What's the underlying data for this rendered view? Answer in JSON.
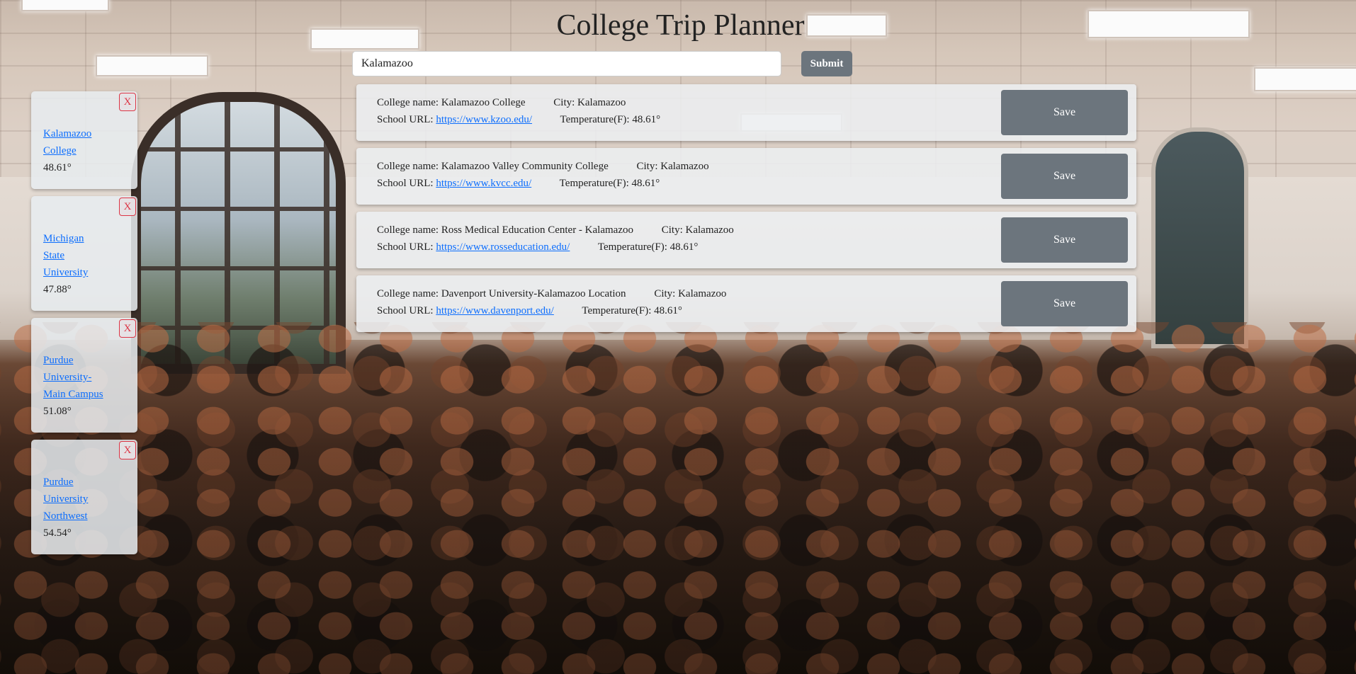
{
  "header": {
    "title": "College Trip Planner"
  },
  "search": {
    "value": "Kalamazoo",
    "submit_label": "Submit"
  },
  "results": [
    {
      "name_label": "College name:",
      "name": "Kalamazoo College",
      "city_label": "City:",
      "city": "Kalamazoo",
      "url_label": "School URL:",
      "url": "https://www.kzoo.edu/",
      "temp_label": "Temperature(F):",
      "temp": "48.61°",
      "save_label": "Save"
    },
    {
      "name_label": "College name:",
      "name": "Kalamazoo Valley Community College",
      "city_label": "City:",
      "city": "Kalamazoo",
      "url_label": "School URL:",
      "url": "https://www.kvcc.edu/",
      "temp_label": "Temperature(F):",
      "temp": "48.61°",
      "save_label": "Save"
    },
    {
      "name_label": "College name:",
      "name": "Ross Medical Education Center - Kalamazoo",
      "city_label": "City:",
      "city": "Kalamazoo",
      "url_label": "School URL:",
      "url": "https://www.rosseducation.edu/",
      "temp_label": "Temperature(F):",
      "temp": "48.61°",
      "save_label": "Save"
    },
    {
      "name_label": "College name:",
      "name": "Davenport University-Kalamazoo Location",
      "city_label": "City:",
      "city": "Kalamazoo",
      "url_label": "School URL:",
      "url": "https://www.davenport.edu/",
      "temp_label": "Temperature(F):",
      "temp": "48.61°",
      "save_label": "Save"
    }
  ],
  "saved": [
    {
      "name_lines": [
        "Kalamazoo",
        "College"
      ],
      "temp": "48.61°",
      "remove_label": "X"
    },
    {
      "name_lines": [
        "Michigan",
        "State",
        "University"
      ],
      "temp": "47.88°",
      "remove_label": "X"
    },
    {
      "name_lines": [
        "Purdue",
        "University-",
        "Main Campus"
      ],
      "temp": "51.08°",
      "remove_label": "X"
    },
    {
      "name_lines": [
        "Purdue",
        "University",
        "Northwest"
      ],
      "temp": "54.54°",
      "remove_label": "X"
    }
  ],
  "colors": {
    "button_gray": "#6c757d",
    "link_blue": "#0d6efd",
    "remove_red": "#dc3545"
  }
}
